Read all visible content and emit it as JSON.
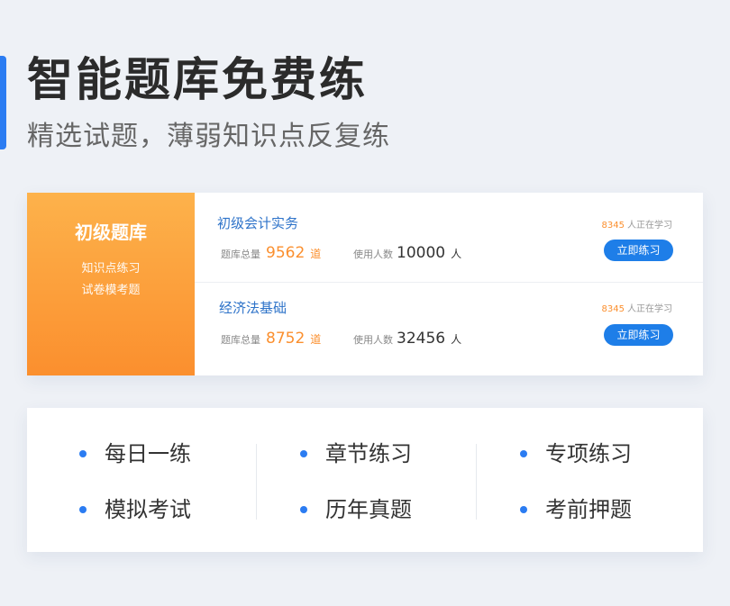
{
  "header": {
    "title": "智能题库免费练",
    "subtitle": "精选试题，薄弱知识点反复练"
  },
  "bank": {
    "side": {
      "title": "初级题库",
      "line1": "知识点练习",
      "line2": "试卷模考题"
    },
    "courses": [
      {
        "name": "初级会计实务",
        "total_label": "题库总量",
        "total_value": "9562",
        "total_unit": "道",
        "users_label": "使用人数",
        "users_value": "10000",
        "users_unit": "人",
        "learning_count": "8345",
        "learning_text": "人正在学习",
        "button_label": "立即练习"
      },
      {
        "name": "经济法基础",
        "total_label": "题库总量",
        "total_value": "8752",
        "total_unit": "道",
        "users_label": "使用人数",
        "users_value": "32456",
        "users_unit": "人",
        "learning_count": "8345",
        "learning_text": "人正在学习",
        "button_label": "立即练习"
      }
    ]
  },
  "modes": [
    "每日一练",
    "章节练习",
    "专项练习",
    "模拟考试",
    "历年真题",
    "考前押题"
  ],
  "colors": {
    "accent_blue": "#2b7cf2",
    "button_blue": "#1e7ee8",
    "orange": "#fb8f2e",
    "background": "#eef1f6"
  }
}
